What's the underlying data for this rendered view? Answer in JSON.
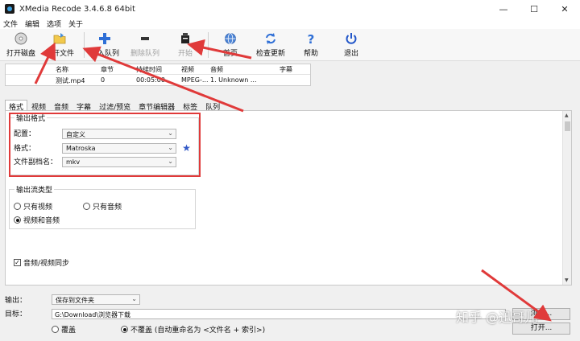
{
  "window": {
    "title": "XMedia Recode 3.4.6.8 64bit",
    "minimize": "—",
    "maximize": "☐",
    "close": "✕"
  },
  "menu": [
    "文件",
    "编辑",
    "选项",
    "关于"
  ],
  "toolbar": {
    "open_disc": "打开磁盘",
    "open_file": "打开文件",
    "add_queue": "加入队列",
    "remove_queue": "删除队列",
    "start": "开始",
    "home": "首页",
    "check_update": "检查更新",
    "help": "帮助",
    "exit": "退出"
  },
  "queue": {
    "headers": [
      "名称",
      "章节",
      "持续时间",
      "视频",
      "音频",
      "字幕"
    ],
    "row": [
      "测试.mp4",
      "0",
      "00:05:00",
      "MPEG-...",
      "1. Unknown ..."
    ]
  },
  "tabs": [
    "格式",
    "视频",
    "音频",
    "字幕",
    "过滤/预览",
    "章节编辑器",
    "标签",
    "队列"
  ],
  "active_tab": "格式",
  "output_format": {
    "group_title": "输出格式",
    "profile_label": "配置：",
    "profile_value": "自定义",
    "format_label": "格式：",
    "format_value": "Matroska",
    "ext_label": "文件副档名：",
    "ext_value": "mkv"
  },
  "stream_type": {
    "group_title": "输出流类型",
    "video_only": "只有视频",
    "audio_only": "只有音频",
    "video_audio": "视频和音频",
    "selected": "视频和音频"
  },
  "av_sync": {
    "label": "音频/视频同步",
    "checked": true
  },
  "output": {
    "output_label": "输出：",
    "output_value": "保存到文件夹",
    "target_label": "目标：",
    "target_value": "G:\\Download\\浏览器下载",
    "overwrite": "覆盖",
    "no_overwrite": "不覆盖 (自动重命名为 <文件名 + 索引>)",
    "browse_button": "浏览...",
    "open_button": "打开..."
  },
  "watermark": "知乎 @迅哥儿",
  "colors": {
    "annotation_red": "#e03a3a",
    "add_icon_blue": "#2f6fd6",
    "exit_blue": "#2357c9"
  }
}
